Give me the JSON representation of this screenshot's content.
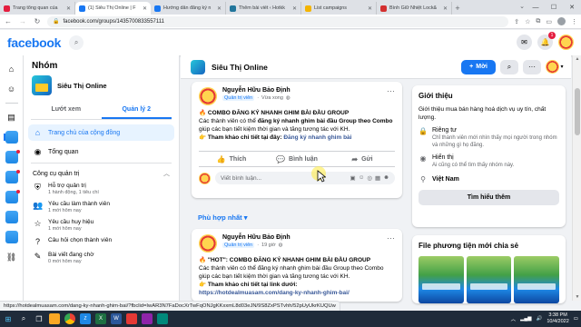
{
  "browser": {
    "tabs": [
      {
        "title": "Trang tổng quan của",
        "favicon_color": "#e41e3f",
        "active": false
      },
      {
        "title": "(1) Siêu Thị Online | F",
        "favicon_color": "#1877f2",
        "active": true
      },
      {
        "title": "Hướng dẫn đăng ký n",
        "favicon_color": "#1877f2",
        "active": false
      },
      {
        "title": "Thêm bài viết ‹ Hotkk",
        "favicon_color": "#21759b",
        "active": false
      },
      {
        "title": "List campaigns",
        "favicon_color": "#f4b400",
        "active": false
      },
      {
        "title": "Bình Giữ Nhiệt Lock&",
        "favicon_color": "#d32f2f",
        "active": false
      }
    ],
    "url": "facebook.com/groups/1435700833557111",
    "status_url": "https://hotdealmuasam.com/dang-ky-nhanh-ghim-bai/?fbclid=IwAR3N7FaDocXrTwFqONJgKKxxmL8d03eJN/9S8ZxPSTvhh/52pUyUkrKUQUw"
  },
  "header": {
    "logo": "facebook",
    "notif_count": "1"
  },
  "group_sidebar": {
    "title": "Nhóm",
    "group_name": "Siêu Thị Online",
    "tabs": [
      "Lướt xem",
      "Quản lý 2"
    ],
    "nav": [
      {
        "label": "Trang chủ của cộng đồng",
        "icon": "home-icon",
        "glyph": "⌂",
        "active": true
      },
      {
        "label": "Tổng quan",
        "icon": "overview-icon",
        "glyph": "◉",
        "active": false
      }
    ],
    "section_title": "Công cụ quản trị",
    "tools": [
      {
        "label": "Hỗ trợ quản trị",
        "sub": "1 hành động, 1 tiêu chí",
        "icon": "admin-assist-icon",
        "glyph": "⛨"
      },
      {
        "label": "Yêu cầu làm thành viên",
        "sub": "1 mới hôm nay",
        "icon": "member-request-icon",
        "glyph": "👥"
      },
      {
        "label": "Yêu cầu huy hiệu",
        "sub": "1 mới hôm nay",
        "icon": "badge-request-icon",
        "glyph": "☆"
      },
      {
        "label": "Câu hỏi chọn thành viên",
        "sub": "",
        "icon": "question-icon",
        "glyph": "?"
      },
      {
        "label": "Bài viết đang chờ",
        "sub": "0 mới hôm nay",
        "icon": "pending-post-icon",
        "glyph": "✎"
      }
    ]
  },
  "feed": {
    "group_name": "Siêu Thị Online",
    "join_label": "Mời",
    "sort_label": "Phù hợp nhất",
    "posts": [
      {
        "author": "Nguyễn Hữu Bảo Định",
        "role": "Quản trị viên",
        "time": "Vừa xong",
        "headline": "COMBO ĐĂNG KÝ NHANH GHIM BÀI ĐẦU GROUP",
        "body_a": "Các thành viên có thể ",
        "body_b": "đăng ký nhanh ghim bài đầu Group theo Combo",
        "body_c": " giúp các bạn tiết kiệm thời gian và tăng tương tác với KH.",
        "cta_label": "Tham khảo chi tiết tại đây: ",
        "cta_link": "Đăng ký nhanh ghim bài",
        "actions": [
          "Thích",
          "Bình luận",
          "Gửi"
        ],
        "comment_placeholder": "Viết bình luận..."
      },
      {
        "author": "Nguyễn Hữu Bảo Định",
        "role": "Quản trị viên",
        "time": "19 giờ",
        "headline": "\"HOT\": COMBO ĐĂNG KÝ NHANH GHIM BÀI ĐẦU GROUP",
        "body_a": "Các thành viên có thể đăng ký nhanh ghim bài đầu Group theo Combo giúp các bạn tiết kiệm thời gian và tăng tương tác với KH.",
        "cta_label": "Tham khảo chi tiết tại link dưới:",
        "cta_link": "https://hotdealmuasam.com/dang-ky-nhanh-ghim-bai/"
      }
    ]
  },
  "about": {
    "title": "Giới thiệu",
    "description": "Giới thiệu mua bán hàng hoá dịch vụ uy tín, chất lượng.",
    "privacy_label": "Riêng tư",
    "privacy_desc": "Chỉ thành viên mới nhìn thấy mọi người trong nhóm và những gì họ đăng.",
    "visibility_label": "Hiển thị",
    "visibility_desc": "Ai cũng có thể tìm thấy nhóm này.",
    "location": "Việt Nam",
    "more_button": "Tìm hiểu thêm"
  },
  "media": {
    "title": "File phương tiện mới chia sẻ"
  },
  "taskbar": {
    "time": "3:38 PM",
    "date": "10/4/2022"
  }
}
